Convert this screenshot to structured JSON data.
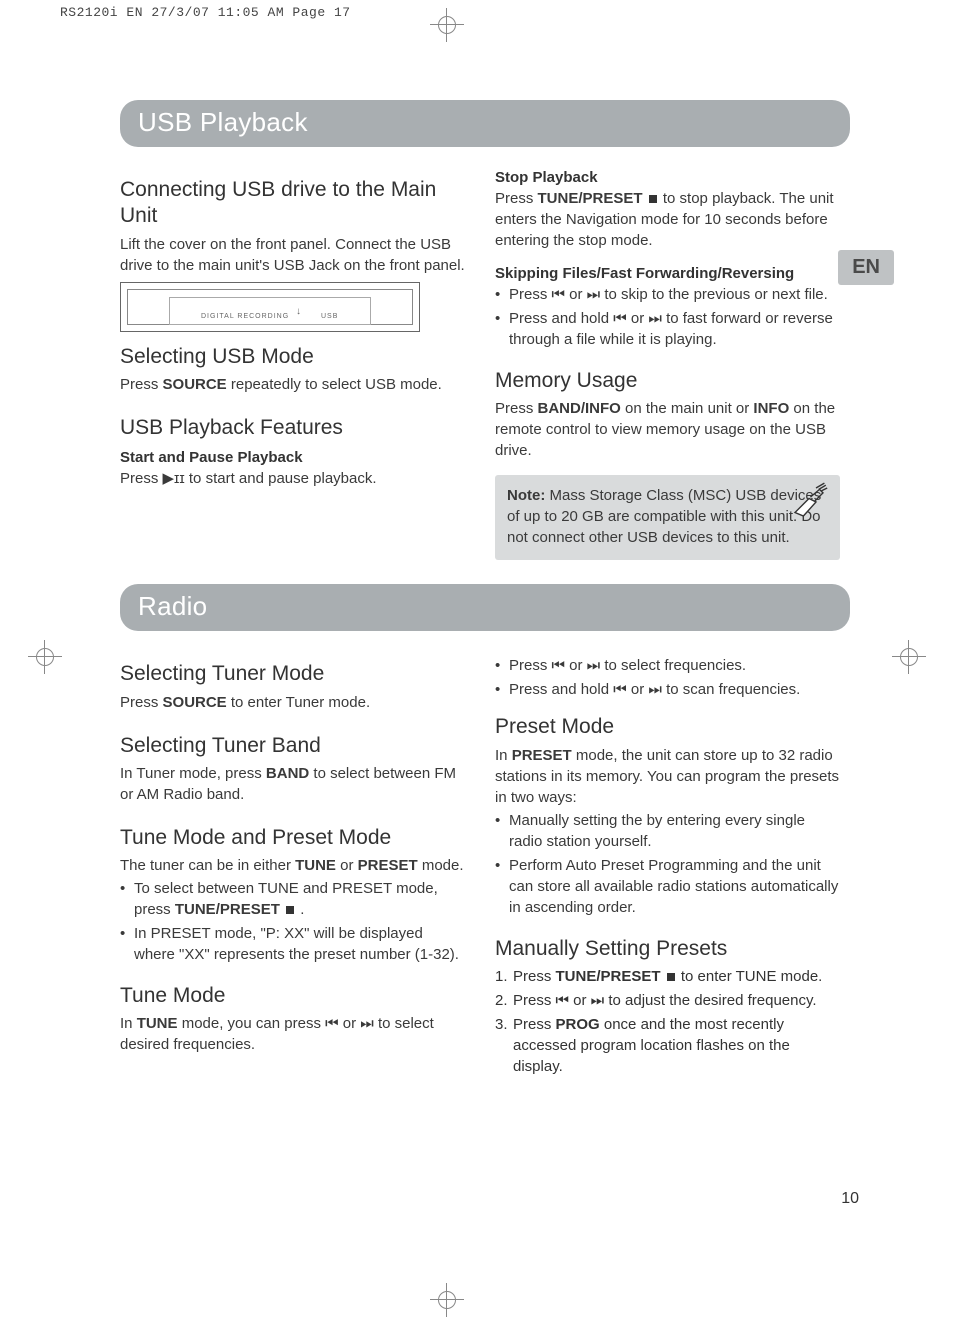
{
  "print_header": "RS2120i EN  27/3/07  11:05 AM  Page 17",
  "lang_tab": "EN",
  "page_number": "10",
  "sections": {
    "usb": {
      "title": "USB Playback",
      "left": {
        "connect_h": "Connecting USB drive to the Main Unit",
        "connect_p": "Lift the cover on the front panel. Connect the USB drive to the main unit's USB Jack on the front panel.",
        "panel_left_label": "DIGITAL RECORDING",
        "panel_right_label": "USB",
        "select_h": "Selecting USB Mode",
        "select_p1": "Press ",
        "select_b1": "SOURCE",
        "select_p2": " repeatedly to select USB mode.",
        "features_h": "USB Playback Features",
        "start_h": "Start and Pause Playback",
        "start_p": "Press  ▶ɪɪ  to start and pause playback."
      },
      "right": {
        "stop_h": "Stop Playback",
        "stop_p1": "Press ",
        "stop_b1": "TUNE/PRESET",
        "stop_p2": "  to stop playback. The unit enters the Navigation mode for 10 seconds before entering the stop mode.",
        "skip_h": "Skipping Files/Fast Forwarding/Reversing",
        "skip_li1": "Press  ⏮  or  ⏭  to skip to the previous or next file.",
        "skip_li2": "Press and hold  ⏮  or  ⏭  to fast forward or reverse through a file while it is playing.",
        "mem_h": "Memory Usage",
        "mem_p1": "Press ",
        "mem_b1": "BAND/INFO",
        "mem_p2": " on the main unit or ",
        "mem_b2": "INFO",
        "mem_p3": " on the remote control to view memory usage on the USB drive.",
        "note_b": "Note:",
        "note_p": " Mass Storage Class (MSC) USB devices of up to 20 GB are compatible with this unit. Do not connect other USB devices to this unit."
      }
    },
    "radio": {
      "title": "Radio",
      "left": {
        "tuner_h": "Selecting Tuner Mode",
        "tuner_p1": "Press ",
        "tuner_b1": "SOURCE",
        "tuner_p2": " to enter Tuner mode.",
        "band_h": "Selecting Tuner Band",
        "band_p1": "In Tuner mode, press ",
        "band_b1": "BAND",
        "band_p2": " to select between FM or AM Radio band.",
        "tunep_h": "Tune Mode and Preset Mode",
        "tunep_p1": "The tuner can be in either ",
        "tunep_b1": "TUNE",
        "tunep_p2": " or ",
        "tunep_b2": "PRESET",
        "tunep_p3": " mode.",
        "tunep_li1a": "To select between TUNE and PRESET mode, press ",
        "tunep_li1b": "TUNE/PRESET",
        "tunep_li1c": " .",
        "tunep_li2": "In PRESET mode, \"P: XX\" will be displayed where \"XX\" represents the preset number (1-32).",
        "tunem_h": "Tune Mode",
        "tunem_p1": "In ",
        "tunem_b1": "TUNE",
        "tunem_p2": " mode, you can press  ⏮  or  ⏭  to select desired frequencies."
      },
      "right": {
        "freq_li1": "Press  ⏮  or  ⏭  to select frequencies.",
        "freq_li2": "Press and hold  ⏮  or  ⏭  to scan frequencies.",
        "preset_h": "Preset Mode",
        "preset_p1": "In ",
        "preset_b1": "PRESET",
        "preset_p2": " mode, the unit can store up to 32 radio stations in its memory. You can program the presets in two ways:",
        "preset_li1": "Manually setting the by entering every single radio station yourself.",
        "preset_li2": "Perform Auto Preset Programming and the unit can store all available radio stations automatically in ascending order.",
        "manp_h": "Manually Setting Presets",
        "manp_li1a": "Press ",
        "manp_li1b": "TUNE/PRESET",
        "manp_li1c": "  to enter TUNE mode.",
        "manp_li2": "Press  ⏮  or  ⏭  to adjust the desired frequency.",
        "manp_li3a": "Press ",
        "manp_li3b": "PROG",
        "manp_li3c": " once and the most recently accessed program location flashes on the display."
      }
    }
  }
}
